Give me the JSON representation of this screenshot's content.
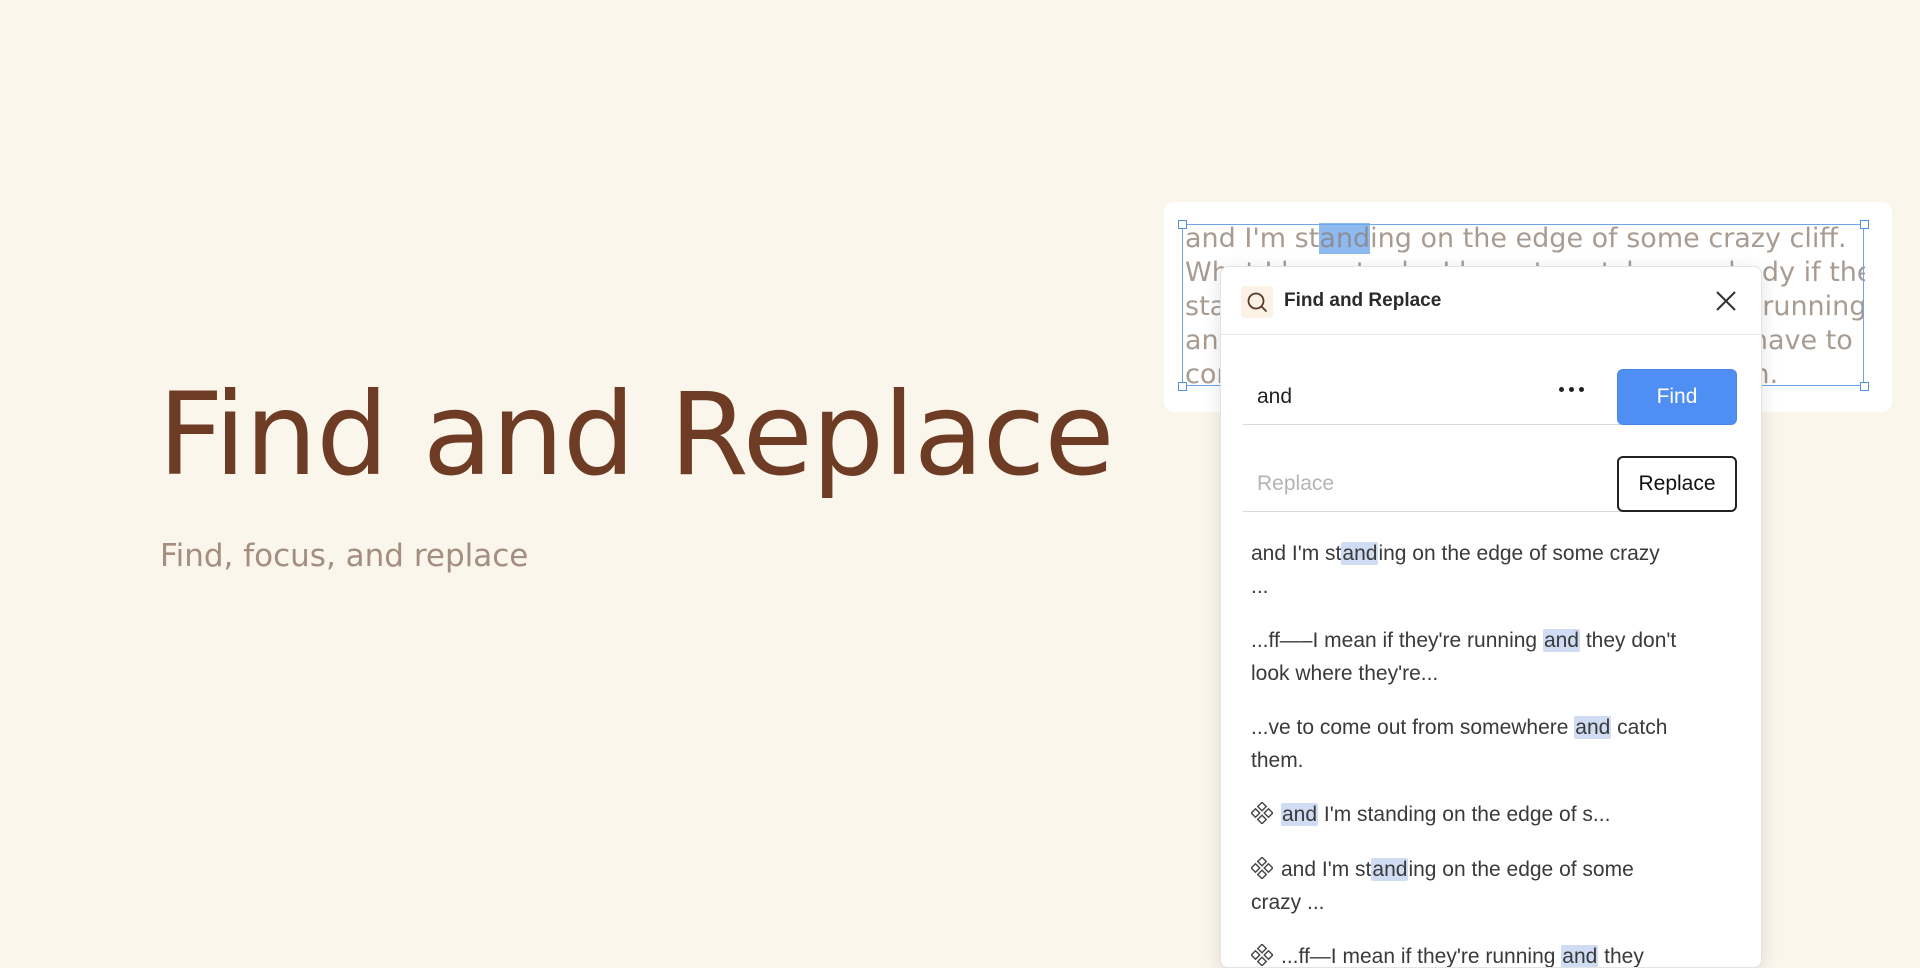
{
  "hero": {
    "title": "Find and Replace",
    "subtitle": "Find, focus, and replace"
  },
  "canvas_text": {
    "lines": [
      [
        "and I'm st",
        "and",
        "ing on the edge of some crazy cliff."
      ],
      [
        "What I have to do, I have to catch everybody if they"
      ],
      [
        "start to go over the cliff—I mean if they're running"
      ],
      [
        "and they don't look where they're going I have to"
      ],
      [
        "come out from somewhere and catch them."
      ]
    ]
  },
  "dialog": {
    "title": "Find and Replace",
    "icons": {
      "header": "search-icon",
      "close": "close-icon",
      "more": "more-icon",
      "component": "component-icon"
    },
    "find_value": "and",
    "replace_placeholder": "Replace",
    "find_button": "Find",
    "replace_button": "Replace",
    "accent_color": "#4f8ff4",
    "highlight_color": "#cfdcf3",
    "results": [
      {
        "icon": false,
        "parts": [
          "and I'm st",
          "and",
          "ing on the edge of some crazy\n..."
        ]
      },
      {
        "icon": false,
        "parts": [
          "...ff—–I mean if they're running ",
          "and",
          " they don't\nlook where they're..."
        ]
      },
      {
        "icon": false,
        "parts": [
          "...ve to come out from somewhere ",
          "and",
          " catch\nthem."
        ]
      },
      {
        "icon": true,
        "parts": [
          "",
          "and",
          " I'm standing on the edge of s..."
        ]
      },
      {
        "icon": true,
        "parts": [
          "and I'm st",
          "and",
          "ing on the edge of some\ncrazy ..."
        ]
      },
      {
        "icon": true,
        "parts": [
          "...ff—I mean if they're running ",
          "and",
          " they"
        ]
      }
    ]
  }
}
